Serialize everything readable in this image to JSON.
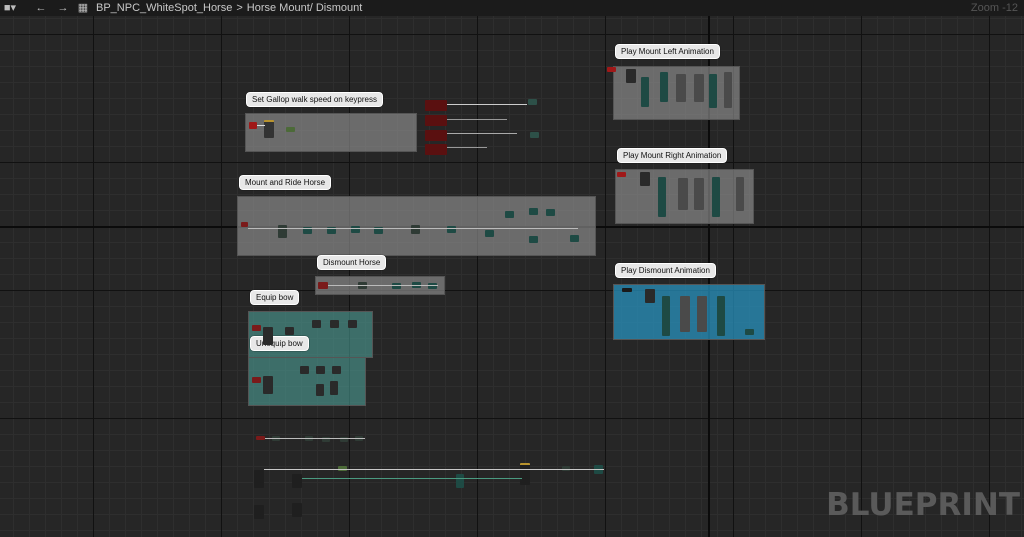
{
  "topbar": {
    "breadcrumb_asset": "BP_NPC_WhiteSpot_Horse",
    "breadcrumb_sep": ">",
    "breadcrumb_graph": "Horse Mount/ Dismount",
    "zoom": "Zoom -12"
  },
  "watermark": "BLUEPRINT",
  "comments": [
    {
      "title": "Set Gallop walk speed on keypress",
      "color": "gray"
    },
    {
      "title": "Mount and Ride Horse",
      "color": "gray"
    },
    {
      "title": "Dismount Horse",
      "color": "gray"
    },
    {
      "title": "Equip bow",
      "color": "teal"
    },
    {
      "title": "Unequip bow",
      "color": "teal"
    },
    {
      "title": "Play Mount Left Animation",
      "color": "gray"
    },
    {
      "title": "Play Mount Right Animation",
      "color": "gray"
    },
    {
      "title": "Play Dismount Animation",
      "color": "blue"
    }
  ]
}
